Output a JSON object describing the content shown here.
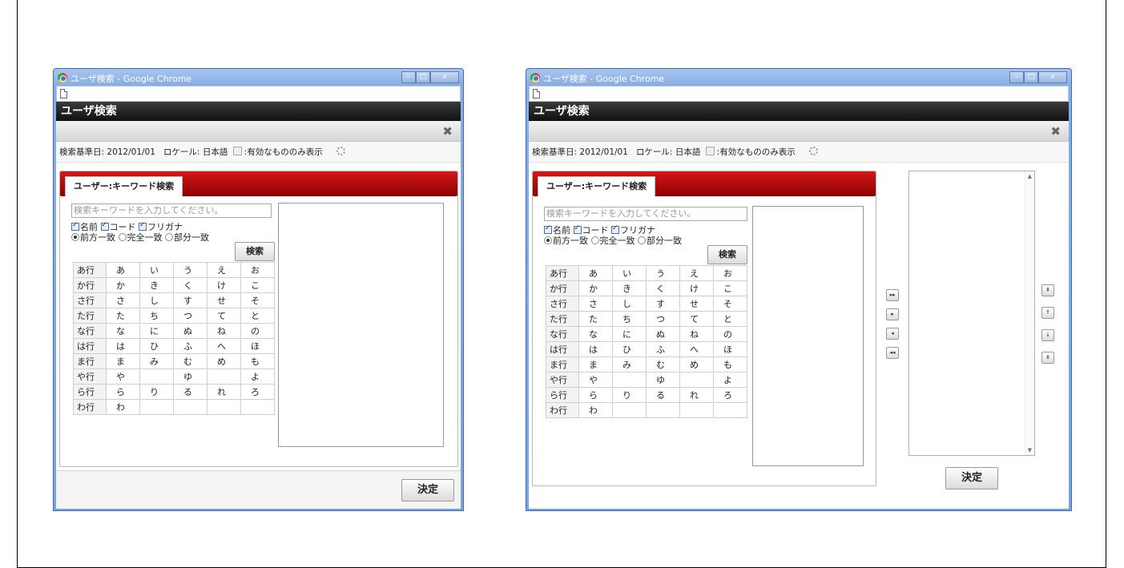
{
  "top_caption": "",
  "windows": [
    {
      "title": "ユーザ検索 - Google Chrome",
      "controls": {
        "minimize": "–",
        "maximize": "□",
        "close": "x"
      },
      "app_title": "ユーザ検索",
      "info": {
        "date_label": "検索基準日:",
        "date": "2012/01/01",
        "locale_label": "ロケール:",
        "locale": "日本語",
        "valid_only": ":有効なもののみ表示"
      },
      "tab_label": "ユーザー:キーワード検索",
      "search_placeholder": "検索キーワードを入力してください。",
      "checks": [
        "名前",
        "コード",
        "フリガナ"
      ],
      "radios": [
        "前方一致",
        "完全一致",
        "部分一致"
      ],
      "search_button": "検索",
      "decide_button": "決定"
    },
    {
      "title": "ユーザ検索 - Google Chrome",
      "controls": {
        "minimize": "–",
        "maximize": "□",
        "close": "x"
      },
      "app_title": "ユーザ検索",
      "info": {
        "date_label": "検索基準日:",
        "date": "2012/01/01",
        "locale_label": "ロケール:",
        "locale": "日本語",
        "valid_only": ":有効なもののみ表示"
      },
      "tab_label": "ユーザー:キーワード検索",
      "search_placeholder": "検索キーワードを入力してください。",
      "checks": [
        "名前",
        "コード",
        "フリガナ"
      ],
      "radios": [
        "前方一致",
        "完全一致",
        "部分一致"
      ],
      "search_button": "検索",
      "decide_button": "決定",
      "move_buttons": [
        "▸▸",
        "▸",
        "◂",
        "◂◂"
      ],
      "order_buttons": [
        "⇞",
        "↑",
        "↓",
        "⇟"
      ]
    }
  ],
  "kana_rows": [
    [
      "あ行",
      "あ",
      "い",
      "う",
      "え",
      "お"
    ],
    [
      "か行",
      "か",
      "き",
      "く",
      "け",
      "こ"
    ],
    [
      "さ行",
      "さ",
      "し",
      "す",
      "せ",
      "そ"
    ],
    [
      "た行",
      "た",
      "ち",
      "つ",
      "て",
      "と"
    ],
    [
      "な行",
      "な",
      "に",
      "ぬ",
      "ね",
      "の"
    ],
    [
      "は行",
      "は",
      "ひ",
      "ふ",
      "へ",
      "ほ"
    ],
    [
      "ま行",
      "ま",
      "み",
      "む",
      "め",
      "も"
    ],
    [
      "や行",
      "や",
      "",
      "ゆ",
      "",
      "よ"
    ],
    [
      "ら行",
      "ら",
      "り",
      "る",
      "れ",
      "ろ"
    ],
    [
      "わ行",
      "わ",
      "",
      "",
      "",
      ""
    ]
  ],
  "icons": {
    "close": "✖",
    "gear": "gear-icon",
    "document": "document-icon",
    "browser": "chrome-icon"
  }
}
